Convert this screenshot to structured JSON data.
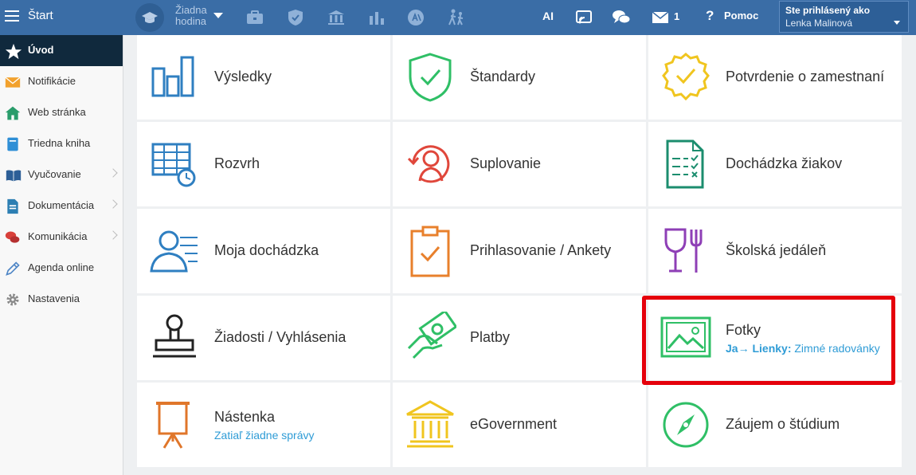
{
  "topbar": {
    "start_label": "Štart",
    "hour_line1": "Žiadna",
    "hour_line2": "hodina",
    "icons": [
      "briefcase-icon",
      "shield-icon",
      "bank-icon",
      "bar-chart-icon",
      "ai-badge-icon",
      "children-walking-icon"
    ],
    "ai_label": "AI",
    "message_count": "1",
    "help_label": "Pomoc",
    "user_label": "Ste prihlásený ako",
    "user_name": "Lenka Malinová"
  },
  "sidebar": {
    "items": [
      {
        "label": "Úvod",
        "icon": "star-icon"
      },
      {
        "label": "Notifikácie",
        "icon": "envelope-icon"
      },
      {
        "label": "Web stránka",
        "icon": "home-icon"
      },
      {
        "label": "Triedna kniha",
        "icon": "book-icon"
      },
      {
        "label": "Vyučovanie",
        "icon": "open-book-icon"
      },
      {
        "label": "Dokumentácia",
        "icon": "document-icon"
      },
      {
        "label": "Komunikácia",
        "icon": "chat-icon"
      },
      {
        "label": "Agenda online",
        "icon": "pencil-icon"
      },
      {
        "label": "Nastavenia",
        "icon": "gear-icon"
      }
    ]
  },
  "tiles": [
    {
      "label": "Výsledky",
      "icon": "bar-chart-icon"
    },
    {
      "label": "Štandardy",
      "icon": "shield-check-icon"
    },
    {
      "label": "Potvrdenie o zamestnaní",
      "icon": "certificate-seal-icon"
    },
    {
      "label": "Rozvrh",
      "icon": "timetable-icon"
    },
    {
      "label": "Suplovanie",
      "icon": "substitute-person-icon"
    },
    {
      "label": "Dochádzka žiakov",
      "icon": "attendance-sheet-icon"
    },
    {
      "label": "Moja dochádzka",
      "icon": "person-list-icon"
    },
    {
      "label": "Prihlasovanie / Ankety",
      "icon": "clipboard-check-icon"
    },
    {
      "label": "Školská jedáleň",
      "icon": "cutlery-icon"
    },
    {
      "label": "Žiadosti / Vyhlásenia",
      "icon": "stamp-icon"
    },
    {
      "label": "Platby",
      "icon": "money-hand-icon"
    },
    {
      "label": "Fotky",
      "icon": "photo-icon",
      "sub_prefix": "Ja→ Lienky:",
      "sub_text": "Zimné radovánky"
    },
    {
      "label": "Nástenka",
      "icon": "flipchart-icon",
      "sub_text": "Zatiaľ žiadne správy"
    },
    {
      "label": "eGovernment",
      "icon": "government-building-icon"
    },
    {
      "label": "Záujem o štúdium",
      "icon": "compass-icon"
    }
  ],
  "colors": {
    "topbar": "#3a6da6",
    "sidebar_active": "#10293d",
    "highlight": "#e5000b",
    "link": "#2f9cd6"
  }
}
